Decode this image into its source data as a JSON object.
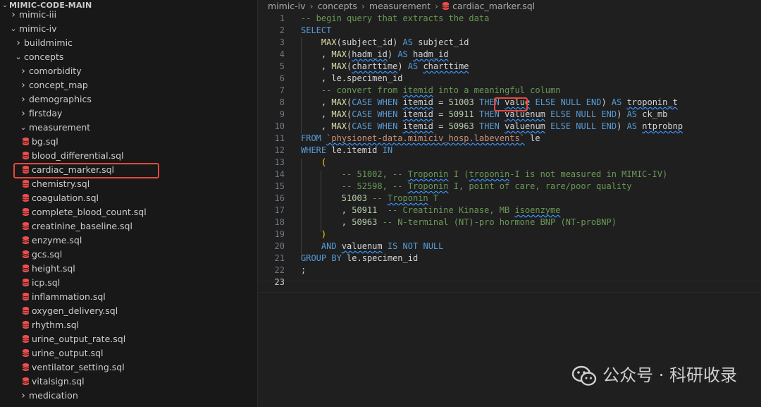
{
  "sidebar": {
    "root_title": "MIMIC-CODE-MAIN",
    "items": [
      {
        "label": "mimic-iii",
        "kind": "folder",
        "expanded": false
      },
      {
        "label": "mimic-iv",
        "kind": "folder",
        "expanded": true
      },
      {
        "label": "buildmimic",
        "kind": "folder",
        "expanded": false
      },
      {
        "label": "concepts",
        "kind": "folder",
        "expanded": true
      },
      {
        "label": "comorbidity",
        "kind": "folder",
        "expanded": false
      },
      {
        "label": "concept_map",
        "kind": "folder",
        "expanded": false
      },
      {
        "label": "demographics",
        "kind": "folder",
        "expanded": false
      },
      {
        "label": "firstday",
        "kind": "folder",
        "expanded": false
      },
      {
        "label": "measurement",
        "kind": "folder",
        "expanded": true
      },
      {
        "label": "bg.sql",
        "kind": "file"
      },
      {
        "label": "blood_differential.sql",
        "kind": "file"
      },
      {
        "label": "cardiac_marker.sql",
        "kind": "file",
        "selected": true
      },
      {
        "label": "chemistry.sql",
        "kind": "file"
      },
      {
        "label": "coagulation.sql",
        "kind": "file"
      },
      {
        "label": "complete_blood_count.sql",
        "kind": "file"
      },
      {
        "label": "creatinine_baseline.sql",
        "kind": "file"
      },
      {
        "label": "enzyme.sql",
        "kind": "file"
      },
      {
        "label": "gcs.sql",
        "kind": "file"
      },
      {
        "label": "height.sql",
        "kind": "file"
      },
      {
        "label": "icp.sql",
        "kind": "file"
      },
      {
        "label": "inflammation.sql",
        "kind": "file"
      },
      {
        "label": "oxygen_delivery.sql",
        "kind": "file"
      },
      {
        "label": "rhythm.sql",
        "kind": "file"
      },
      {
        "label": "urine_output_rate.sql",
        "kind": "file"
      },
      {
        "label": "urine_output.sql",
        "kind": "file"
      },
      {
        "label": "ventilator_setting.sql",
        "kind": "file"
      },
      {
        "label": "vitalsign.sql",
        "kind": "file"
      },
      {
        "label": "medication",
        "kind": "folder",
        "expanded": false
      }
    ]
  },
  "breadcrumb": [
    "mimic-iv",
    "concepts",
    "measurement",
    "cardiac_marker.sql"
  ],
  "editor": {
    "line_numbers": [
      "1",
      "2",
      "3",
      "4",
      "5",
      "6",
      "7",
      "8",
      "9",
      "10",
      "11",
      "12",
      "13",
      "14",
      "15",
      "16",
      "17",
      "18",
      "19",
      "20",
      "21",
      "22",
      "23"
    ],
    "active_line": "23"
  },
  "watermark": {
    "text": "公众号 · 科研收录"
  },
  "colors": {
    "accent_red": "#e5483d",
    "db_icon": "#f14c4c",
    "keyword": "#569cd6",
    "function": "#dcdcaa",
    "comment": "#6a9955",
    "number": "#b5cea8",
    "string": "#ce9178"
  },
  "icons": {
    "file": "database-icon",
    "folder_open": "chevron-down-icon",
    "folder_closed": "chevron-right-icon"
  }
}
